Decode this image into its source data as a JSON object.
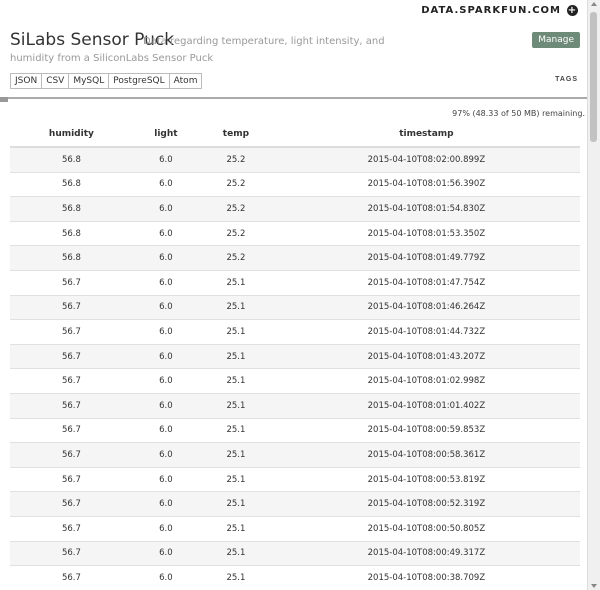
{
  "header": {
    "site_link": "DATA.SPARKFUN.COM",
    "site_icon": "plus-circle-icon",
    "title": "SiLabs Sensor Puck",
    "description": "Data regarding temperature, light intensity, and humidity from a SiliconLabs Sensor Puck",
    "manage_label": "Manage"
  },
  "exports": [
    "JSON",
    "CSV",
    "MySQL",
    "PostgreSQL",
    "Atom"
  ],
  "tags_label": "TAGS",
  "remaining_text": "97% (48.33 of 50 MB) remaining.",
  "table": {
    "columns": [
      "humidity",
      "light",
      "temp",
      "timestamp"
    ],
    "rows": [
      [
        "56.8",
        "6.0",
        "25.2",
        "2015-04-10T08:02:00.899Z"
      ],
      [
        "56.8",
        "6.0",
        "25.2",
        "2015-04-10T08:01:56.390Z"
      ],
      [
        "56.8",
        "6.0",
        "25.2",
        "2015-04-10T08:01:54.830Z"
      ],
      [
        "56.8",
        "6.0",
        "25.2",
        "2015-04-10T08:01:53.350Z"
      ],
      [
        "56.8",
        "6.0",
        "25.2",
        "2015-04-10T08:01:49.779Z"
      ],
      [
        "56.7",
        "6.0",
        "25.1",
        "2015-04-10T08:01:47.754Z"
      ],
      [
        "56.7",
        "6.0",
        "25.1",
        "2015-04-10T08:01:46.264Z"
      ],
      [
        "56.7",
        "6.0",
        "25.1",
        "2015-04-10T08:01:44.732Z"
      ],
      [
        "56.7",
        "6.0",
        "25.1",
        "2015-04-10T08:01:43.207Z"
      ],
      [
        "56.7",
        "6.0",
        "25.1",
        "2015-04-10T08:01:02.998Z"
      ],
      [
        "56.7",
        "6.0",
        "25.1",
        "2015-04-10T08:01:01.402Z"
      ],
      [
        "56.7",
        "6.0",
        "25.1",
        "2015-04-10T08:00:59.853Z"
      ],
      [
        "56.7",
        "6.0",
        "25.1",
        "2015-04-10T08:00:58.361Z"
      ],
      [
        "56.7",
        "6.0",
        "25.1",
        "2015-04-10T08:00:53.819Z"
      ],
      [
        "56.7",
        "6.0",
        "25.1",
        "2015-04-10T08:00:52.319Z"
      ],
      [
        "56.7",
        "6.0",
        "25.1",
        "2015-04-10T08:00:50.805Z"
      ],
      [
        "56.7",
        "6.0",
        "25.1",
        "2015-04-10T08:00:49.317Z"
      ],
      [
        "56.7",
        "6.0",
        "25.1",
        "2015-04-10T08:00:38.709Z"
      ]
    ]
  },
  "colors": {
    "manage_button": "#6e8a78",
    "row_stripe": "#f5f5f5"
  }
}
